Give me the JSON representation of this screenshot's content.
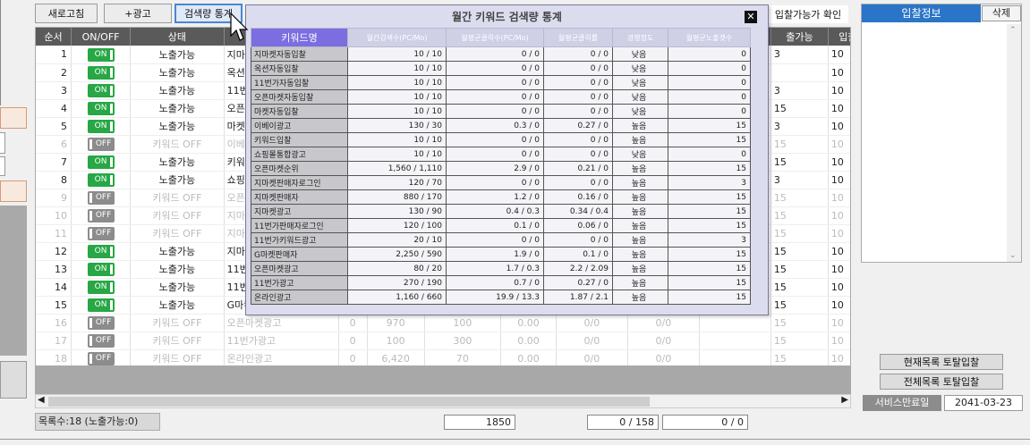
{
  "toolbar": {
    "refresh": "새로고침",
    "add_ad": "+광고",
    "search_stats": "검색량 통계",
    "bid_check": "입찰가능가 확인"
  },
  "grid": {
    "headers": [
      "순서",
      "ON/OFF",
      "상태",
      "",
      "",
      "",
      "",
      "",
      "",
      "",
      "",
      "",
      "출가능",
      "입찰단위"
    ],
    "rows": [
      {
        "n": "1",
        "on": true,
        "status": "노출가능",
        "kw": "지마켓",
        "c5": "",
        "c6": "",
        "c7": "",
        "c8": "",
        "c9": "",
        "c10": "",
        "c11": "",
        "c12": "3",
        "c13": "10"
      },
      {
        "n": "2",
        "on": true,
        "status": "노출가능",
        "kw": "옥션자",
        "c5": "",
        "c6": "",
        "c7": "",
        "c8": "",
        "c9": "",
        "c10": "",
        "c11": "",
        "c12": "",
        "c13": "10"
      },
      {
        "n": "3",
        "on": true,
        "status": "노출가능",
        "kw": "11번가",
        "c5": "",
        "c6": "",
        "c7": "",
        "c8": "",
        "c9": "",
        "c10": "",
        "c11": "",
        "c12": "3",
        "c13": "10"
      },
      {
        "n": "4",
        "on": true,
        "status": "노출가능",
        "kw": "오픈마",
        "c5": "",
        "c6": "",
        "c7": "",
        "c8": "",
        "c9": "",
        "c10": "",
        "c11": "",
        "c12": "15",
        "c13": "10"
      },
      {
        "n": "5",
        "on": true,
        "status": "노출가능",
        "kw": "마켓자",
        "c5": "",
        "c6": "",
        "c7": "",
        "c8": "",
        "c9": "",
        "c10": "",
        "c11": "",
        "c12": "3",
        "c13": "10"
      },
      {
        "n": "6",
        "on": false,
        "status": "키워드 OFF",
        "kw": "이베이",
        "c5": "",
        "c6": "",
        "c7": "",
        "c8": "",
        "c9": "",
        "c10": "",
        "c11": "",
        "c12": "15",
        "c13": "10"
      },
      {
        "n": "7",
        "on": true,
        "status": "노출가능",
        "kw": "키워드",
        "c5": "",
        "c6": "",
        "c7": "",
        "c8": "",
        "c9": "",
        "c10": "",
        "c11": "",
        "c12": "15",
        "c13": "10"
      },
      {
        "n": "8",
        "on": true,
        "status": "노출가능",
        "kw": "쇼핑몰",
        "c5": "",
        "c6": "",
        "c7": "",
        "c8": "",
        "c9": "",
        "c10": "",
        "c11": "",
        "c12": "3",
        "c13": "10"
      },
      {
        "n": "9",
        "on": false,
        "status": "키워드 OFF",
        "kw": "오픈마",
        "c5": "",
        "c6": "",
        "c7": "",
        "c8": "",
        "c9": "",
        "c10": "",
        "c11": "",
        "c12": "15",
        "c13": "10"
      },
      {
        "n": "10",
        "on": false,
        "status": "키워드 OFF",
        "kw": "지마켓",
        "c5": "",
        "c6": "",
        "c7": "",
        "c8": "",
        "c9": "",
        "c10": "",
        "c11": "",
        "c12": "15",
        "c13": "10"
      },
      {
        "n": "11",
        "on": false,
        "status": "키워드 OFF",
        "kw": "지마켓",
        "c5": "",
        "c6": "",
        "c7": "",
        "c8": "",
        "c9": "",
        "c10": "",
        "c11": "",
        "c12": "15",
        "c13": "10"
      },
      {
        "n": "12",
        "on": true,
        "status": "노출가능",
        "kw": "지마켓",
        "c5": "",
        "c6": "",
        "c7": "",
        "c8": "",
        "c9": "",
        "c10": "",
        "c11": "",
        "c12": "15",
        "c13": "10"
      },
      {
        "n": "13",
        "on": true,
        "status": "노출가능",
        "kw": "11번가",
        "c5": "",
        "c6": "",
        "c7": "",
        "c8": "",
        "c9": "",
        "c10": "",
        "c11": "",
        "c12": "15",
        "c13": "10"
      },
      {
        "n": "14",
        "on": true,
        "status": "노출가능",
        "kw": "11번가",
        "c5": "",
        "c6": "",
        "c7": "",
        "c8": "",
        "c9": "",
        "c10": "",
        "c11": "",
        "c12": "15",
        "c13": "10"
      },
      {
        "n": "15",
        "on": true,
        "status": "노출가능",
        "kw": "G마켓",
        "c5": "",
        "c6": "",
        "c7": "",
        "c8": "",
        "c9": "",
        "c10": "",
        "c11": "",
        "c12": "15",
        "c13": "10"
      },
      {
        "n": "16",
        "on": false,
        "status": "키워드 OFF",
        "kw": "오픈마켓광고",
        "c5": "0",
        "c6": "970",
        "c7": "100",
        "c8": "0.00",
        "c9": "0/0",
        "c10": "",
        "c11": "0/0",
        "c12": "15",
        "c13": "10"
      },
      {
        "n": "17",
        "on": false,
        "status": "키워드 OFF",
        "kw": "11번가광고",
        "c5": "0",
        "c6": "100",
        "c7": "300",
        "c8": "0.00",
        "c9": "0/0",
        "c10": "",
        "c11": "0/0",
        "c12": "15",
        "c13": "10"
      },
      {
        "n": "18",
        "on": false,
        "status": "키워드 OFF",
        "kw": "온라인광고",
        "c5": "0",
        "c6": "6,420",
        "c7": "70",
        "c8": "0.00",
        "c9": "0/0",
        "c10": "",
        "c11": "0/0",
        "c12": "15",
        "c13": "10"
      }
    ],
    "on_label": "ON",
    "off_label": "OFF"
  },
  "modal": {
    "title": "월간 키워드 검색량 통계",
    "close": "✕",
    "headers": [
      "키워드명",
      "월간검색수(PC/Mo)",
      "월평균클릭수(PC/Mo)",
      "월평균클릭률",
      "경쟁정도",
      "월평균노출갯수"
    ],
    "rows": [
      [
        "지마켓자동입찰",
        "10 / 10",
        "0 / 0",
        "0 / 0",
        "낮음",
        "0"
      ],
      [
        "옥션자동입찰",
        "10 / 10",
        "0 / 0",
        "0 / 0",
        "낮음",
        "0"
      ],
      [
        "11번가자동입찰",
        "10 / 10",
        "0 / 0",
        "0 / 0",
        "낮음",
        "0"
      ],
      [
        "오픈마켓자동입찰",
        "10 / 10",
        "0 / 0",
        "0 / 0",
        "낮음",
        "0"
      ],
      [
        "마켓자동입찰",
        "10 / 10",
        "0 / 0",
        "0 / 0",
        "낮음",
        "0"
      ],
      [
        "이베이광고",
        "130 / 30",
        "0.3 / 0",
        "0.27 / 0",
        "높음",
        "15"
      ],
      [
        "키워드입찰",
        "10 / 10",
        "0 / 0",
        "0 / 0",
        "높음",
        "15"
      ],
      [
        "쇼핑몰통합광고",
        "10 / 10",
        "0 / 0",
        "0 / 0",
        "낮음",
        "0"
      ],
      [
        "오픈마켓순위",
        "1,560 / 1,110",
        "2.9 / 0",
        "0.21 / 0",
        "높음",
        "15"
      ],
      [
        "지마켓판매자로그인",
        "120 / 70",
        "0 / 0",
        "0 / 0",
        "높음",
        "3"
      ],
      [
        "지마켓판매자",
        "880 / 170",
        "1.2 / 0",
        "0.16 / 0",
        "높음",
        "15"
      ],
      [
        "지마켓광고",
        "130 / 90",
        "0.4 / 0.3",
        "0.34 / 0.4",
        "높음",
        "15"
      ],
      [
        "11번가판매자로그인",
        "120 / 100",
        "0.1 / 0",
        "0.06 / 0",
        "높음",
        "15"
      ],
      [
        "11번가키워드광고",
        "20 / 10",
        "0 / 0",
        "0 / 0",
        "높음",
        "3"
      ],
      [
        "G마켓판매자",
        "2,250 / 590",
        "1.9 / 0",
        "0.1 / 0",
        "높음",
        "15"
      ],
      [
        "오픈마켓광고",
        "80 / 20",
        "1.7 / 0.3",
        "2.2 / 2.09",
        "높음",
        "15"
      ],
      [
        "11번가광고",
        "270 / 190",
        "0.7 / 0",
        "0.27 / 0",
        "높음",
        "15"
      ],
      [
        "온라인광고",
        "1,160 / 660",
        "19.9 / 13.3",
        "1.87 / 2.1",
        "높음",
        "15"
      ]
    ]
  },
  "right": {
    "header": "입찰정보",
    "delete": "삭제",
    "current_total": "현재목록 토탈입찰",
    "all_total": "전체목록 토탈입찰",
    "service_label": "서비스만료일",
    "service_date": "2041-03-23"
  },
  "footer": {
    "count": "목록수:18 (노출가능:0)",
    "v1": "1850",
    "v2": "0 / 158",
    "v3": "0 / 0"
  }
}
